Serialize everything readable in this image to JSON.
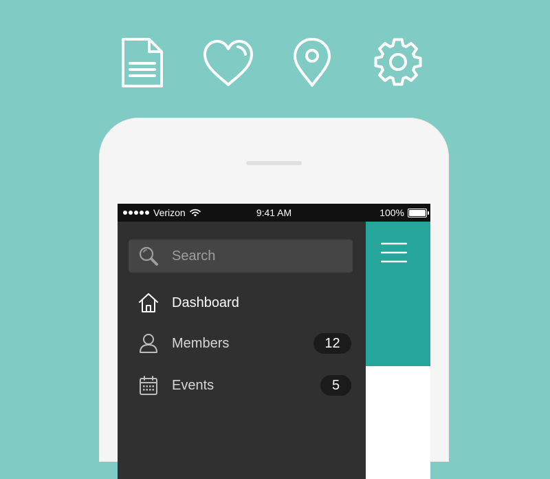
{
  "colors": {
    "background": "#80CBC4",
    "accent": "#26A69A",
    "drawer": "#303030",
    "status_bar": "#111111",
    "badge": "#1B1B1B"
  },
  "top_icons": [
    {
      "name": "document-icon"
    },
    {
      "name": "heart-icon"
    },
    {
      "name": "location-pin-icon"
    },
    {
      "name": "gear-icon"
    }
  ],
  "status_bar": {
    "carrier": "Verizon",
    "time": "9:41 AM",
    "battery": "100%",
    "battery_level": 1.0,
    "signal_bars": 5
  },
  "drawer": {
    "search": {
      "placeholder": "Search",
      "icon": "search-icon"
    },
    "items": [
      {
        "label": "Dashboard",
        "icon": "home-icon",
        "active": true
      },
      {
        "label": "Members",
        "icon": "person-icon",
        "badge": "12"
      },
      {
        "label": "Events",
        "icon": "calendar-icon",
        "badge": "5"
      }
    ]
  },
  "header": {
    "menu_icon": "hamburger-menu-icon"
  }
}
